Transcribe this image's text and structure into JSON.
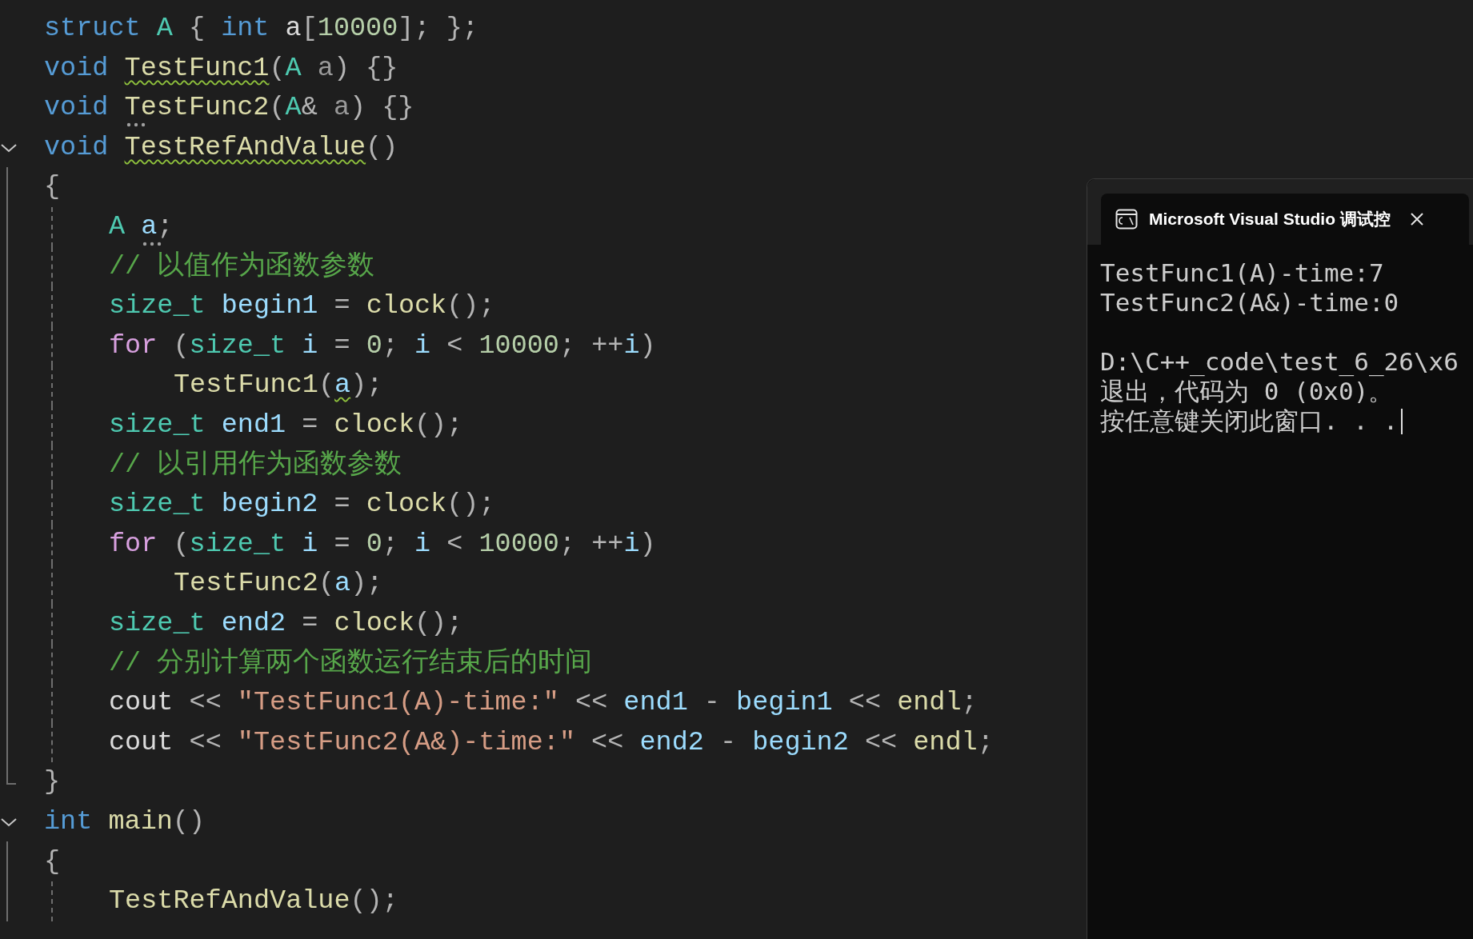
{
  "editor": {
    "lines": [
      {
        "tokens": [
          {
            "text": "struct ",
            "kind": "keyword"
          },
          {
            "text": "A",
            "kind": "type"
          },
          {
            "text": " { ",
            "kind": "punct"
          },
          {
            "text": "int ",
            "kind": "keyword"
          },
          {
            "text": "a",
            "kind": "plain"
          },
          {
            "text": "[",
            "kind": "punct"
          },
          {
            "text": "10000",
            "kind": "number"
          },
          {
            "text": "]; };",
            "kind": "punct"
          }
        ]
      },
      {
        "tokens": [
          {
            "text": "void ",
            "kind": "keyword"
          },
          {
            "text": "TestFunc1",
            "kind": "function",
            "squiggle": true
          },
          {
            "text": "(",
            "kind": "punct"
          },
          {
            "text": "A ",
            "kind": "type"
          },
          {
            "text": "a",
            "kind": "param"
          },
          {
            "text": ") {}",
            "kind": "punct"
          }
        ]
      },
      {
        "tokens": [
          {
            "text": "void ",
            "kind": "keyword"
          },
          {
            "text": "TestFunc2",
            "kind": "function",
            "hint": true
          },
          {
            "text": "(",
            "kind": "punct"
          },
          {
            "text": "A",
            "kind": "type"
          },
          {
            "text": "& ",
            "kind": "punct"
          },
          {
            "text": "a",
            "kind": "param"
          },
          {
            "text": ") {}",
            "kind": "punct"
          }
        ]
      },
      {
        "tokens": [
          {
            "text": "void ",
            "kind": "keyword"
          },
          {
            "text": "TestRefAndValue",
            "kind": "function",
            "squiggle": true
          },
          {
            "text": "()",
            "kind": "punct"
          }
        ],
        "expanded": true,
        "block": {
          "open": "{",
          "close": "}",
          "lines": [
            {
              "tokens": [
                {
                  "text": "A ",
                  "kind": "type"
                },
                {
                  "text": "a",
                  "kind": "variable",
                  "hint": true
                },
                {
                  "text": ";",
                  "kind": "punct"
                }
              ]
            },
            {
              "tokens": [
                {
                  "text": "// 以值作为函数参数",
                  "kind": "comment"
                }
              ]
            },
            {
              "tokens": [
                {
                  "text": "size_t ",
                  "kind": "type"
                },
                {
                  "text": "begin1",
                  "kind": "variable"
                },
                {
                  "text": " = ",
                  "kind": "punct"
                },
                {
                  "text": "clock",
                  "kind": "function"
                },
                {
                  "text": "();",
                  "kind": "punct"
                }
              ]
            },
            {
              "tokens": [
                {
                  "text": "for",
                  "kind": "control"
                },
                {
                  "text": " (",
                  "kind": "punct"
                },
                {
                  "text": "size_t ",
                  "kind": "type"
                },
                {
                  "text": "i",
                  "kind": "variable"
                },
                {
                  "text": " = ",
                  "kind": "punct"
                },
                {
                  "text": "0",
                  "kind": "number"
                },
                {
                  "text": "; ",
                  "kind": "punct"
                },
                {
                  "text": "i",
                  "kind": "variable"
                },
                {
                  "text": " < ",
                  "kind": "punct"
                },
                {
                  "text": "10000",
                  "kind": "number"
                },
                {
                  "text": "; ++",
                  "kind": "punct"
                },
                {
                  "text": "i",
                  "kind": "variable"
                },
                {
                  "text": ")",
                  "kind": "punct"
                }
              ],
              "children": [
                {
                  "tokens": [
                    {
                      "text": "TestFunc1",
                      "kind": "function"
                    },
                    {
                      "text": "(",
                      "kind": "punct"
                    },
                    {
                      "text": "a",
                      "kind": "variable",
                      "squiggle": true
                    },
                    {
                      "text": ");",
                      "kind": "punct"
                    }
                  ]
                }
              ]
            },
            {
              "tokens": [
                {
                  "text": "size_t ",
                  "kind": "type"
                },
                {
                  "text": "end1",
                  "kind": "variable"
                },
                {
                  "text": " = ",
                  "kind": "punct"
                },
                {
                  "text": "clock",
                  "kind": "function"
                },
                {
                  "text": "();",
                  "kind": "punct"
                }
              ]
            },
            {
              "tokens": [
                {
                  "text": "// 以引用作为函数参数",
                  "kind": "comment"
                }
              ]
            },
            {
              "tokens": [
                {
                  "text": "size_t ",
                  "kind": "type"
                },
                {
                  "text": "begin2",
                  "kind": "variable"
                },
                {
                  "text": " = ",
                  "kind": "punct"
                },
                {
                  "text": "clock",
                  "kind": "function"
                },
                {
                  "text": "();",
                  "kind": "punct"
                }
              ]
            },
            {
              "tokens": [
                {
                  "text": "for",
                  "kind": "control"
                },
                {
                  "text": " (",
                  "kind": "punct"
                },
                {
                  "text": "size_t ",
                  "kind": "type"
                },
                {
                  "text": "i",
                  "kind": "variable"
                },
                {
                  "text": " = ",
                  "kind": "punct"
                },
                {
                  "text": "0",
                  "kind": "number"
                },
                {
                  "text": "; ",
                  "kind": "punct"
                },
                {
                  "text": "i",
                  "kind": "variable"
                },
                {
                  "text": " < ",
                  "kind": "punct"
                },
                {
                  "text": "10000",
                  "kind": "number"
                },
                {
                  "text": "; ++",
                  "kind": "punct"
                },
                {
                  "text": "i",
                  "kind": "variable"
                },
                {
                  "text": ")",
                  "kind": "punct"
                }
              ],
              "children": [
                {
                  "tokens": [
                    {
                      "text": "TestFunc2",
                      "kind": "function"
                    },
                    {
                      "text": "(",
                      "kind": "punct"
                    },
                    {
                      "text": "a",
                      "kind": "variable"
                    },
                    {
                      "text": ");",
                      "kind": "punct"
                    }
                  ]
                }
              ]
            },
            {
              "tokens": [
                {
                  "text": "size_t ",
                  "kind": "type"
                },
                {
                  "text": "end2",
                  "kind": "variable"
                },
                {
                  "text": " = ",
                  "kind": "punct"
                },
                {
                  "text": "clock",
                  "kind": "function"
                },
                {
                  "text": "();",
                  "kind": "punct"
                }
              ]
            },
            {
              "tokens": [
                {
                  "text": "// 分别计算两个函数运行结束后的时间",
                  "kind": "comment"
                }
              ]
            },
            {
              "tokens": [
                {
                  "text": "cout",
                  "kind": "plain"
                },
                {
                  "text": " << ",
                  "kind": "punct"
                },
                {
                  "text": "\"TestFunc1(A)-time:\"",
                  "kind": "string"
                },
                {
                  "text": " << ",
                  "kind": "punct"
                },
                {
                  "text": "end1",
                  "kind": "variable"
                },
                {
                  "text": " - ",
                  "kind": "punct"
                },
                {
                  "text": "begin1",
                  "kind": "variable"
                },
                {
                  "text": " << ",
                  "kind": "punct"
                },
                {
                  "text": "endl",
                  "kind": "function"
                },
                {
                  "text": ";",
                  "kind": "punct"
                }
              ]
            },
            {
              "tokens": [
                {
                  "text": "cout",
                  "kind": "plain"
                },
                {
                  "text": " << ",
                  "kind": "punct"
                },
                {
                  "text": "\"TestFunc2(A&)-time:\"",
                  "kind": "string"
                },
                {
                  "text": " << ",
                  "kind": "punct"
                },
                {
                  "text": "end2",
                  "kind": "variable"
                },
                {
                  "text": " - ",
                  "kind": "punct"
                },
                {
                  "text": "begin2",
                  "kind": "variable"
                },
                {
                  "text": " << ",
                  "kind": "punct"
                },
                {
                  "text": "endl",
                  "kind": "function"
                },
                {
                  "text": ";",
                  "kind": "punct"
                }
              ]
            }
          ]
        }
      },
      {
        "tokens": [
          {
            "text": "int ",
            "kind": "keyword"
          },
          {
            "text": "main",
            "kind": "function"
          },
          {
            "text": "()",
            "kind": "punct"
          }
        ],
        "expanded": true,
        "block": {
          "open": "{",
          "lines": [
            {
              "tokens": [
                {
                  "text": "TestRefAndValue",
                  "kind": "function"
                },
                {
                  "text": "();",
                  "kind": "punct"
                }
              ]
            }
          ]
        }
      }
    ]
  },
  "console": {
    "title": "Microsoft Visual Studio 调试控",
    "paragraphs": [
      {
        "lines": [
          {
            "text": "TestFunc1(A)-time:7",
            "cursor": false
          },
          {
            "text": "TestFunc2(A&)-time:0",
            "cursor": false
          }
        ]
      },
      {
        "lines": [
          {
            "text": "D:\\C++_code\\test_6_26\\x6",
            "cursor": false
          },
          {
            "text": "退出，代码为 0 (0x0)。",
            "cursor": false
          },
          {
            "text": "按任意键关闭此窗口. . .",
            "cursor": true
          }
        ]
      }
    ]
  }
}
